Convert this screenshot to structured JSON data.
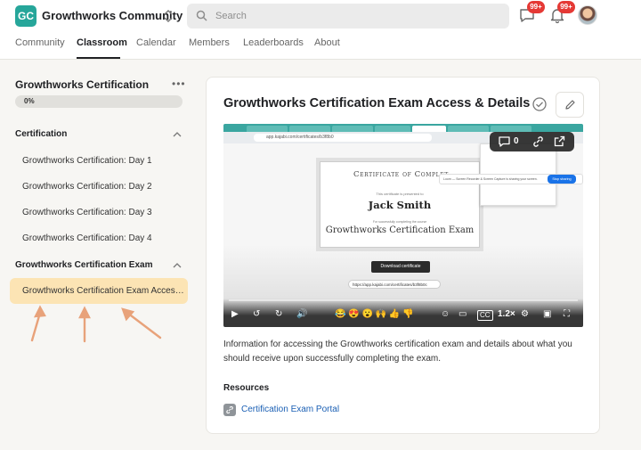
{
  "header": {
    "logo_text": "GC",
    "community_name": "Growthworks Community",
    "search_placeholder": "Search",
    "chat_badge": "99+",
    "bell_badge": "99+",
    "accent_color": "#26a69a"
  },
  "nav": {
    "tabs": [
      {
        "label": "Community"
      },
      {
        "label": "Classroom"
      },
      {
        "label": "Calendar"
      },
      {
        "label": "Members"
      },
      {
        "label": "Leaderboards"
      },
      {
        "label": "About"
      }
    ],
    "active_tab": "Classroom"
  },
  "sidebar": {
    "course_title": "Growthworks Certification",
    "progress_text": "0%",
    "progress_value": 0,
    "sections": [
      {
        "title": "Certification",
        "lessons": [
          "Growthworks Certification: Day 1",
          "Growthworks Certification: Day 2",
          "Growthworks Certification: Day 3",
          "Growthworks Certification: Day 4"
        ]
      },
      {
        "title": "Growthworks Certification Exam",
        "lessons": [
          "Growthworks Certification Exam Access & Details"
        ]
      }
    ]
  },
  "lesson": {
    "title": "Growthworks Certification Exam Access & Details",
    "description": "Information for accessing the Growthworks certification exam and details about what you should receive upon successfully completing the exam.",
    "resources_heading": "Resources",
    "resource_link": "Certification Exam Portal"
  },
  "video": {
    "comment_count": "0",
    "speed": "1.2×",
    "url_text": "app.kajabi.com/certificates/b3f8b0",
    "certificate": {
      "heading": "Certificate of Complet",
      "presented_to": "This certificate is presented to",
      "name": "Jack Smith",
      "completing": "For successfully completing the course",
      "course": "Growthworks Certification Exam",
      "download_label": "Download certificate",
      "link": "https://app.kajabi.com/certificates/b3f8b0c"
    },
    "share_banner": "Loom — Screen Recorder & Screen Capture is sharing your screen.",
    "stop_sharing": "Stop sharing"
  }
}
